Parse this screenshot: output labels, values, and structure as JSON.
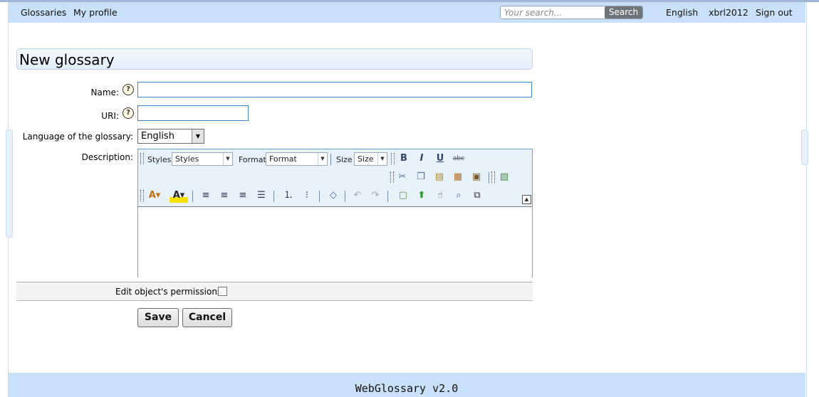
{
  "nav": {
    "left": [
      "Glossaries",
      "My profile"
    ],
    "search_placeholder": "Your search...",
    "search_button": "Search",
    "right": [
      "English",
      "xbrl2012",
      "Sign out"
    ]
  },
  "form": {
    "title": "New glossary",
    "name_label": "Name:",
    "uri_label": "URI:",
    "language_label": "Language of the glossary:",
    "language_value": "English",
    "description_label": "Description:",
    "permissions_label": "Edit object's permissions:",
    "save": "Save",
    "cancel": "Cancel"
  },
  "editor": {
    "styles_label": "Styles",
    "styles_value": "Styles",
    "format_label": "Format",
    "format_value": "Format",
    "size_label": "Size",
    "size_value": "Size",
    "bold": "B",
    "italic": "I",
    "underline": "U",
    "strike": "abc",
    "icons_row1": [
      "bold-icon",
      "italic-icon",
      "underline-icon",
      "strikethrough-icon"
    ],
    "icons_row2": [
      "cut-icon",
      "copy-icon",
      "paste-icon",
      "paste-text-icon",
      "paste-word-icon",
      "image-icon"
    ],
    "icons_row3": [
      "text-color-icon",
      "background-color-icon",
      "align-left-icon",
      "align-center-icon",
      "align-right-icon",
      "justify-icon",
      "numbered-list-icon",
      "bullet-list-icon",
      "eraser-icon",
      "undo-icon",
      "redo-icon",
      "new-page-icon",
      "upload-icon",
      "select-icon",
      "find-replace-icon",
      "copy-format-icon"
    ]
  },
  "footer": {
    "text": "WebGlossary v2.0"
  }
}
